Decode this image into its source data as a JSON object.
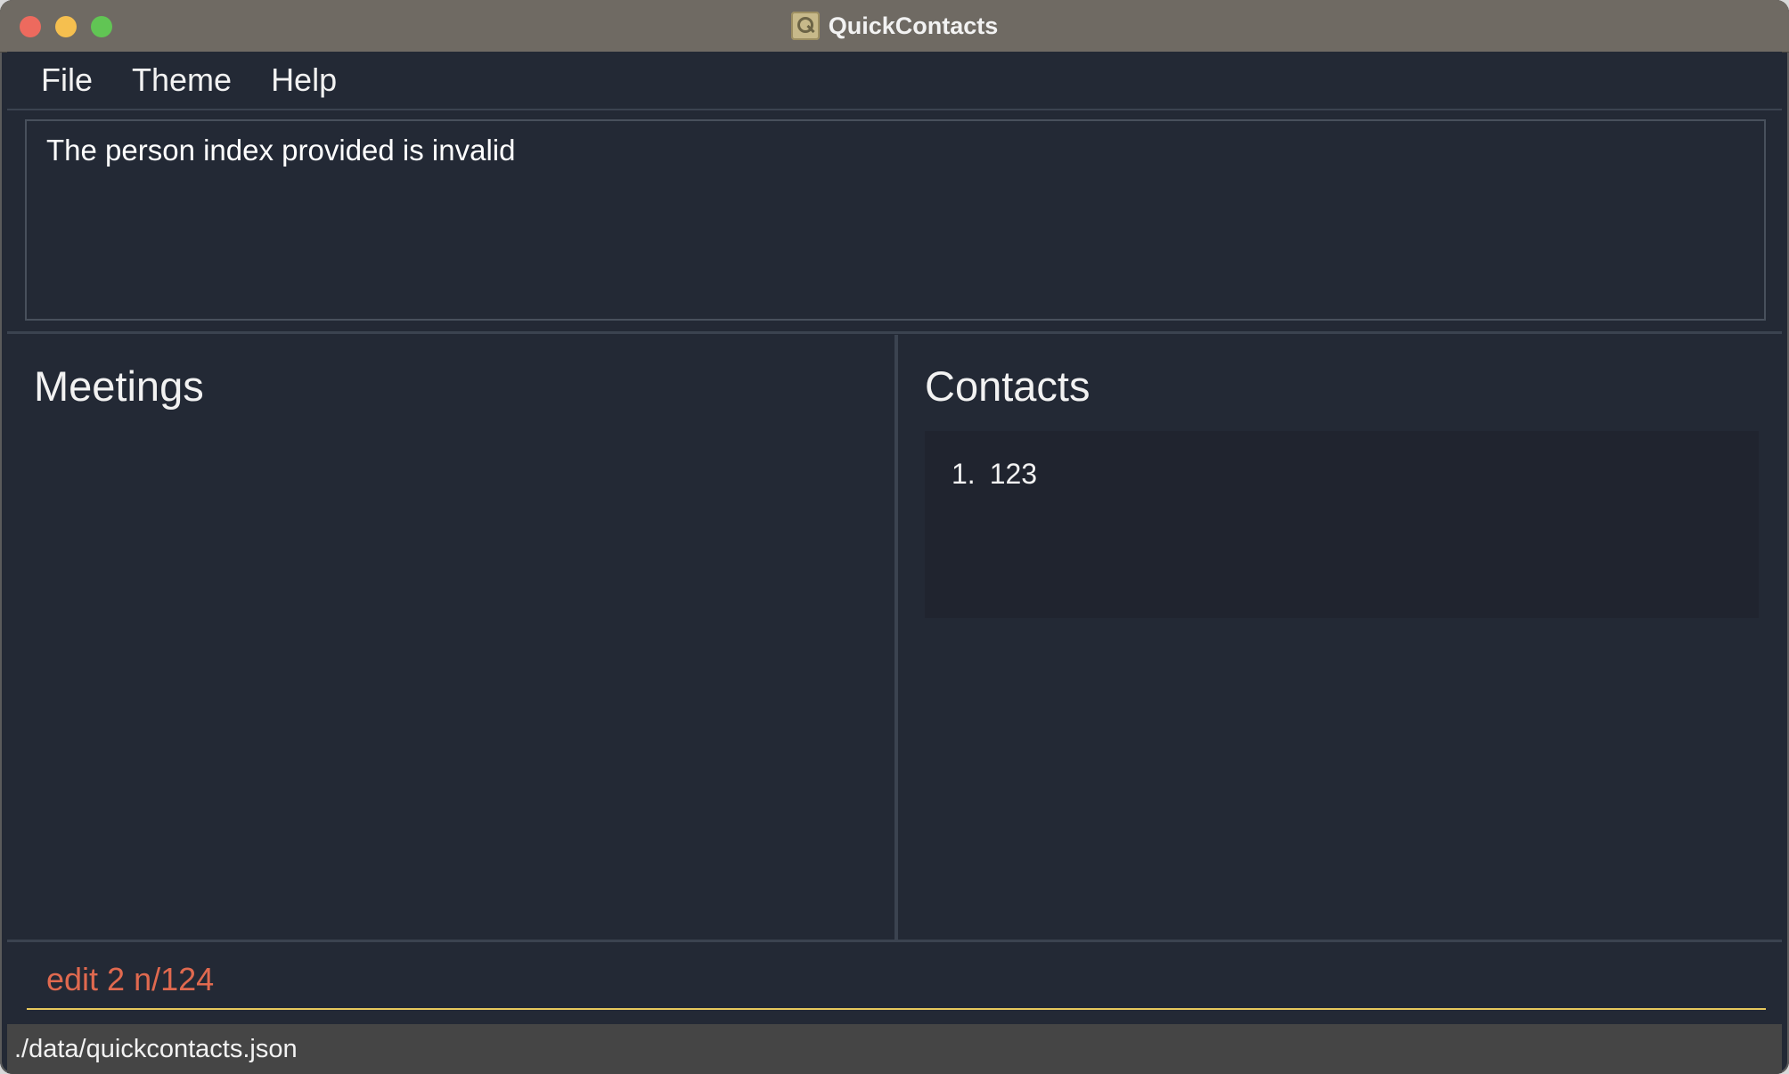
{
  "window": {
    "title": "QuickContacts",
    "app_icon": "quickcontacts-app-icon"
  },
  "menubar": {
    "items": [
      {
        "label": "File"
      },
      {
        "label": "Theme"
      },
      {
        "label": "Help"
      }
    ]
  },
  "result_display": {
    "text": "The person index provided is invalid"
  },
  "meetings": {
    "title": "Meetings",
    "items": []
  },
  "contacts": {
    "title": "Contacts",
    "items": [
      {
        "index": "1.",
        "name": "123"
      }
    ]
  },
  "command_box": {
    "value": "edit 2 n/124",
    "text_color": "#e0694f",
    "underline_color": "#e7c85d"
  },
  "status_bar": {
    "path": "./data/quickcontacts.json"
  },
  "colors": {
    "background": "#232935",
    "titlebar": "#6f6a63",
    "close": "#ed6a5e",
    "minimize": "#f5bf4f",
    "zoom": "#61c554"
  }
}
